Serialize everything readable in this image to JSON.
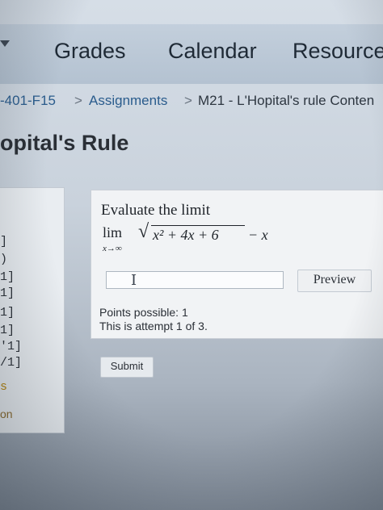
{
  "nav": {
    "items": [
      "Grades",
      "Calendar",
      "Resources"
    ]
  },
  "breadcrumb": {
    "course": "-401-F15",
    "sep": ">",
    "assignments": "Assignments",
    "current": "M21 - L'Hopital's rule Conten"
  },
  "page": {
    "title": "opital's Rule"
  },
  "left_panel": {
    "items": [
      "]",
      ")",
      "1]",
      "1]",
      "1]",
      "1]",
      "'1]",
      "/1]",
      "s",
      "on"
    ]
  },
  "question": {
    "prompt": "Evaluate the limit",
    "lim": "lim",
    "lim_sub": "x→∞",
    "radicand": "x² + 4x + 6",
    "tail": "− x",
    "answer_value": "",
    "preview_label": "Preview",
    "points_possible": "Points possible: 1",
    "attempt": "This is attempt 1 of 3."
  },
  "submit_label": "Submit",
  "colors": {
    "link": "#2a5c8d",
    "nav_bg": "#b4c2d1",
    "panel_bg": "#f1f3f5"
  }
}
